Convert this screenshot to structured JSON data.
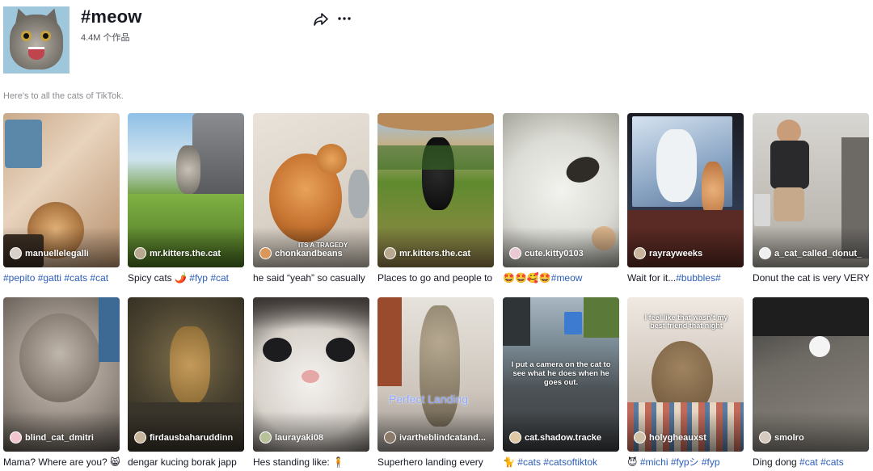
{
  "header": {
    "hashtag": "#meow",
    "post_count": "4.4M 个作品",
    "share_icon": "share-arrow-icon",
    "more_icon": "more-horizontal-icon",
    "description": "Here's to all the cats of TikTok."
  },
  "videos": [
    {
      "author": "manuellelegalli",
      "caption": "",
      "tags": "#pepito #gatti #cats #cat",
      "overlay": ""
    },
    {
      "author": "mr.kitters.the.cat",
      "caption": "Spicy cats 🌶️ ",
      "tags": "#fyp #cat",
      "overlay": ""
    },
    {
      "author": "chonkandbeans",
      "caption": "he said “yeah” so casually",
      "tags": "",
      "overlay": "ITS A TRAGEDY"
    },
    {
      "author": "mr.kitters.the.cat",
      "caption": "Places to go and people to",
      "tags": "",
      "overlay": ""
    },
    {
      "author": "cute.kitty0103",
      "caption": "🤩🤩🥰🤩",
      "tags": "#meow",
      "overlay": ""
    },
    {
      "author": "rayrayweeks",
      "caption": "Wait for it...",
      "tags": "#bubbles#",
      "overlay": ""
    },
    {
      "author": "a_cat_called_donut_",
      "caption": "Donut the cat is very VERY",
      "tags": "",
      "overlay": ""
    },
    {
      "author": "blind_cat_dmitri",
      "caption": "Mama? Where are you? 😸",
      "tags": "",
      "overlay": ""
    },
    {
      "author": "firdausbaharuddinn",
      "caption": "dengar kucing borak japp",
      "tags": "",
      "overlay": ""
    },
    {
      "author": "laurayaki08",
      "caption": "Hes standing like: 🧍",
      "tags": "",
      "overlay": ""
    },
    {
      "author": "ivartheblindcatand...",
      "caption": "Superhero landing every",
      "tags": "",
      "overlay": "Perfect Landing"
    },
    {
      "author": "cat.shadow.tracke",
      "caption": "🐈 ",
      "tags": "#cats #catsoftiktok",
      "overlay": "I put a camera on the cat to see what he does when he goes out."
    },
    {
      "author": "holygheauxst",
      "caption": "😈 ",
      "tags": "#michi #fypシ #fyp",
      "overlay": "I feel like that wasn't my best friend that night"
    },
    {
      "author": "smolro",
      "caption": "Ding dong ",
      "tags": "#cat #cats",
      "overlay": ""
    }
  ]
}
